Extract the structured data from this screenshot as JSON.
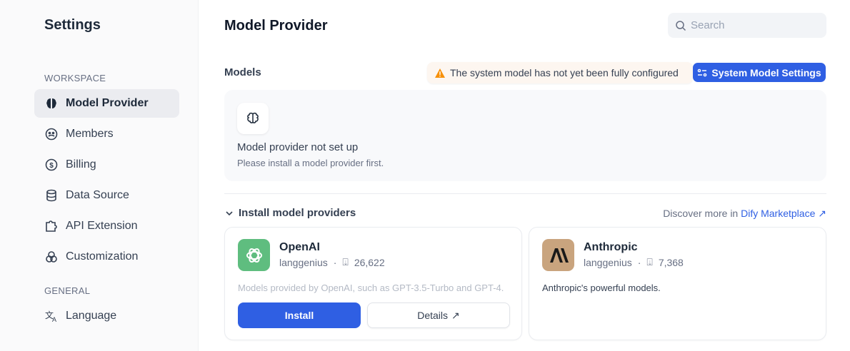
{
  "sidebar": {
    "title": "Settings",
    "workspace_label": "WORKSPACE",
    "general_label": "GENERAL",
    "items": [
      {
        "label": "Model Provider",
        "icon": "brain-icon"
      },
      {
        "label": "Members",
        "icon": "members-icon"
      },
      {
        "label": "Billing",
        "icon": "dollar-icon"
      },
      {
        "label": "Data Source",
        "icon": "database-icon"
      },
      {
        "label": "API Extension",
        "icon": "puzzle-icon"
      },
      {
        "label": "Customization",
        "icon": "circles-icon"
      }
    ],
    "general_items": [
      {
        "label": "Language",
        "icon": "translate-icon"
      }
    ]
  },
  "header": {
    "title": "Model Provider",
    "search_placeholder": "Search"
  },
  "models": {
    "label": "Models",
    "warning": "The system model has not yet been fully configured",
    "system_button": "System Model Settings",
    "empty_title": "Model provider not set up",
    "empty_sub": "Please install a model provider first."
  },
  "install": {
    "label": "Install model providers",
    "discover": "Discover more in ",
    "marketplace": "Dify Marketplace",
    "cards": [
      {
        "name": "OpenAI",
        "author": "langgenius",
        "downloads": "26,622",
        "desc": "Models provided by OpenAI, such as GPT-3.5-Turbo and GPT-4.",
        "install": "Install",
        "details": "Details"
      },
      {
        "name": "Anthropic",
        "author": "langgenius",
        "downloads": "7,368",
        "desc": "Anthropic's powerful models."
      }
    ]
  },
  "colors": {
    "accent": "#2f5fe3",
    "warning": "#f79009",
    "openai": "#5fbd7f",
    "anthropic": "#c9a47e"
  }
}
